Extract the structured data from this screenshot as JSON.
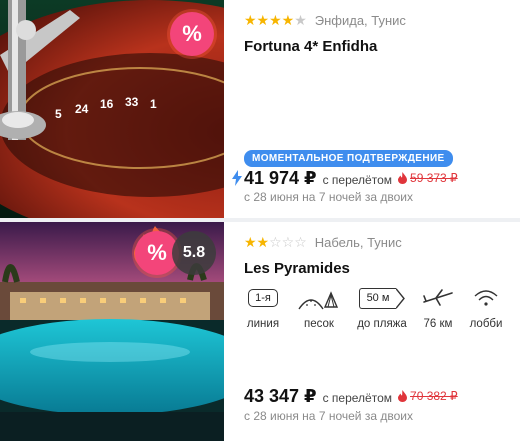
{
  "cards": [
    {
      "stars_filled": 4,
      "stars_total": 5,
      "location": "Энфида, Тунис",
      "name": "Fortuna 4* Enfidha",
      "instant_label": "МОМЕНТАЛЬНОЕ ПОДТВЕРЖДЕНИЕ",
      "price": "41 974 ₽",
      "price_note": "с перелётом",
      "old_price": "59 373 ₽",
      "dates": "с 28 июня на 7 ночей за двоих",
      "sale_icon": "%"
    },
    {
      "stars_filled": 2,
      "stars_total": 5,
      "location": "Набель, Тунис",
      "name": "Les Pyramides",
      "rating": "5.8",
      "price": "43 347 ₽",
      "price_note": "с перелётом",
      "old_price": "70 382 ₽",
      "dates": "с 28 июня на 7 ночей за двоих",
      "sale_icon": "%",
      "amenities": [
        {
          "tag": "1-я",
          "label": "линия",
          "icon": "line-tag"
        },
        {
          "label": "песок",
          "icon": "sand-icon"
        },
        {
          "tag": "50 м",
          "label": "до пляжа",
          "icon": "distance-tag"
        },
        {
          "label": "76 км",
          "icon": "airplane-icon"
        },
        {
          "label": "лобби",
          "icon": "wifi-icon"
        }
      ]
    }
  ],
  "colors": {
    "accent": "#3f8dee",
    "sale": "#f3457a",
    "old_price": "#e0353b",
    "star": "#f7b500"
  }
}
